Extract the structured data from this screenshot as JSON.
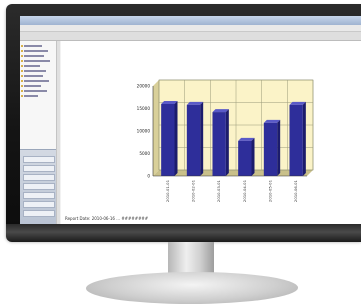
{
  "window": {
    "title": ""
  },
  "report": {
    "footer_text": "Report Date: 2010-06-16 ... ########"
  },
  "icons": {
    "monitor": "monitor-icon",
    "tree": "folder-icon"
  },
  "colors": {
    "bar": "#2e2e9a",
    "plot_background": "#fbf3c8",
    "bezel": "#151515"
  },
  "chart_data": {
    "type": "bar",
    "categories": [
      "2010-01-01",
      "2010-02-01",
      "2010-03-01",
      "2010-04-01",
      "2010-05-01",
      "2010-06-01"
    ],
    "values": [
      16000,
      15800,
      14200,
      7800,
      11800,
      15800
    ],
    "yticks": [
      "20000",
      "15000",
      "10000",
      "5000",
      "0"
    ],
    "ylim": [
      0,
      20000
    ],
    "grid": true,
    "title": "",
    "xlabel": "",
    "ylabel": ""
  }
}
